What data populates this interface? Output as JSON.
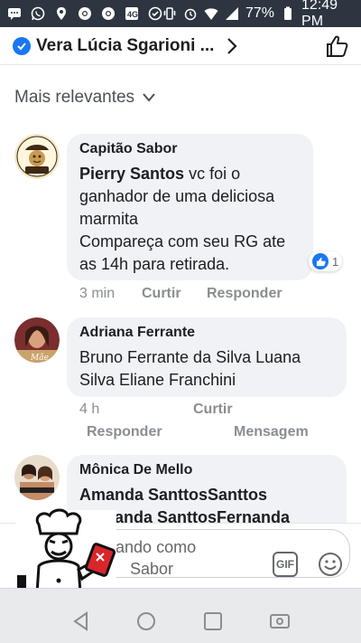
{
  "status_bar": {
    "battery_pct": "77%",
    "time": "12:49 PM",
    "left_icons": [
      "messages-icon",
      "whatsapp-icon",
      "location-pin-icon",
      "chrome-icon",
      "chrome-icon",
      "network-icon",
      "app-icon"
    ],
    "right_icons": [
      "vibrate-icon",
      "alarm-icon",
      "wifi-icon",
      "signal-icon",
      "battery-icon"
    ]
  },
  "header": {
    "title": "Vera Lúcia Sgarioni ...",
    "verified_icon": "verified-badge-icon",
    "chevron_icon": "chevron-right-icon",
    "like_icon": "thumbs-up-icon"
  },
  "sort": {
    "label": "Mais relevantes",
    "icon": "chevron-down-icon"
  },
  "comments": [
    {
      "author": "Capitão Sabor",
      "mention": "Pierry Santos",
      "text_after_mention": " vc foi o ganhador de uma deliciosa marmita",
      "text_line2": "Compareça com seu RG ate as 14h para retirada.",
      "time": "3 min",
      "like": "Curtir",
      "reply": "Responder",
      "reaction_count": "1",
      "reaction_icon": "like-reaction-icon"
    },
    {
      "author": "Adriana Ferrante",
      "text": "Bruno Ferrante da Silva Luana Silva Eliane Franchini",
      "time": "4 h",
      "like": "Curtir",
      "reply": "Responder",
      "message": "Mensagem"
    },
    {
      "author": "Mônica De Mello",
      "text": "Amanda SanttosSanttos Fernanda SanttosFernanda"
    }
  ],
  "composer": {
    "placeholder_line1": "omentando como",
    "placeholder_line2": "Sabor",
    "gif_label": "GIF",
    "emoji_icon": "emoji-icon"
  },
  "navbar": {
    "icons": [
      "back-icon",
      "home-icon",
      "recents-icon",
      "screen-toggle-icon"
    ]
  },
  "colors": {
    "facebook_blue": "#1877f2",
    "bubble": "#f0f2f5",
    "status_bar": "#2d3540"
  }
}
